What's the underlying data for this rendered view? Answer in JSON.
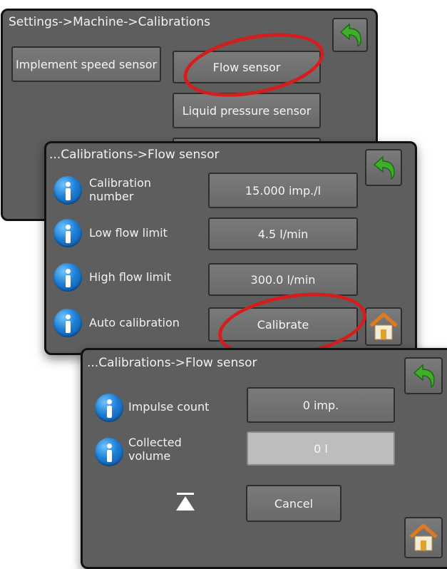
{
  "panel1": {
    "title": "Settings->Machine->Calibrations",
    "buttons": {
      "implement_speed": "Implement speed sensor",
      "flow_sensor": "Flow sensor",
      "liquid_pressure": "Liquid pressure sensor"
    }
  },
  "panel2": {
    "title": "...Calibrations->Flow sensor",
    "rows": [
      {
        "label": "Calibration number",
        "value": "15.000 imp./l"
      },
      {
        "label": "Low flow limit",
        "value": "4.5 l/min"
      },
      {
        "label": "High flow limit",
        "value": "300.0 l/min"
      },
      {
        "label": "Auto calibration",
        "value": "Calibrate"
      }
    ]
  },
  "panel3": {
    "title": "...Calibrations->Flow sensor",
    "rows": [
      {
        "label": "Impulse count",
        "value": "0 imp."
      },
      {
        "label": "Collected volume",
        "value": "0 l"
      }
    ],
    "cancel": "Cancel"
  },
  "colors": {
    "highlight": "#d41e1e",
    "back_arrow": "#3fae2a",
    "info": "#1e7fd6",
    "home_roof": "#e07a22"
  },
  "icons": [
    "back-arrow-icon",
    "info-icon",
    "home-icon",
    "eject-icon"
  ]
}
